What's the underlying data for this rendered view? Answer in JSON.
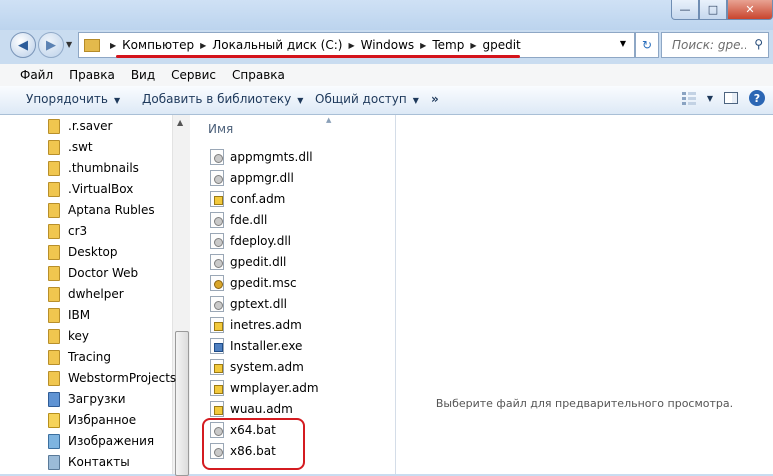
{
  "address": {
    "crumbs": [
      "Компьютер",
      "Локальный диск (C:)",
      "Windows",
      "Temp",
      "gpedit"
    ]
  },
  "search": {
    "placeholder": "Поиск: gpe..."
  },
  "menu": [
    "Файл",
    "Правка",
    "Вид",
    "Сервис",
    "Справка"
  ],
  "toolbar": {
    "organize": "Упорядочить",
    "add_library": "Добавить в библиотеку",
    "share": "Общий доступ",
    "more": "»"
  },
  "nav_items": [
    {
      "label": ".r.saver",
      "icon": "folder-icon"
    },
    {
      "label": ".swt",
      "icon": "folder-icon"
    },
    {
      "label": ".thumbnails",
      "icon": "folder-icon"
    },
    {
      "label": ".VirtualBox",
      "icon": "folder-icon"
    },
    {
      "label": "Aptana Rubles",
      "icon": "folder-icon"
    },
    {
      "label": "cr3",
      "icon": "folder-icon"
    },
    {
      "label": "Desktop",
      "icon": "folder-icon"
    },
    {
      "label": "Doctor Web",
      "icon": "folder-icon"
    },
    {
      "label": "dwhelper",
      "icon": "folder-icon"
    },
    {
      "label": "IBM",
      "icon": "folder-icon"
    },
    {
      "label": "key",
      "icon": "folder-icon"
    },
    {
      "label": "Tracing",
      "icon": "folder-icon"
    },
    {
      "label": "WebstormProjects",
      "icon": "folder-icon"
    },
    {
      "label": "Загрузки",
      "icon": "downloads-icon"
    },
    {
      "label": "Избранное",
      "icon": "favorites-icon"
    },
    {
      "label": "Изображения",
      "icon": "pictures-icon"
    },
    {
      "label": "Контакты",
      "icon": "contacts-icon"
    }
  ],
  "file_list": {
    "column": "Имя",
    "files": [
      {
        "name": "appmgmts.dll",
        "type": "dll"
      },
      {
        "name": "appmgr.dll",
        "type": "dll"
      },
      {
        "name": "conf.adm",
        "type": "adm"
      },
      {
        "name": "fde.dll",
        "type": "dll"
      },
      {
        "name": "fdeploy.dll",
        "type": "dll"
      },
      {
        "name": "gpedit.dll",
        "type": "dll"
      },
      {
        "name": "gpedit.msc",
        "type": "msc"
      },
      {
        "name": "gptext.dll",
        "type": "dll"
      },
      {
        "name": "inetres.adm",
        "type": "adm"
      },
      {
        "name": "Installer.exe",
        "type": "exe"
      },
      {
        "name": "system.adm",
        "type": "adm"
      },
      {
        "name": "wmplayer.adm",
        "type": "adm"
      },
      {
        "name": "wuau.adm",
        "type": "adm"
      },
      {
        "name": "x64.bat",
        "type": "bat"
      },
      {
        "name": "x86.bat",
        "type": "bat"
      }
    ]
  },
  "preview": {
    "message": "Выберите файл для предварительного просмотра."
  }
}
